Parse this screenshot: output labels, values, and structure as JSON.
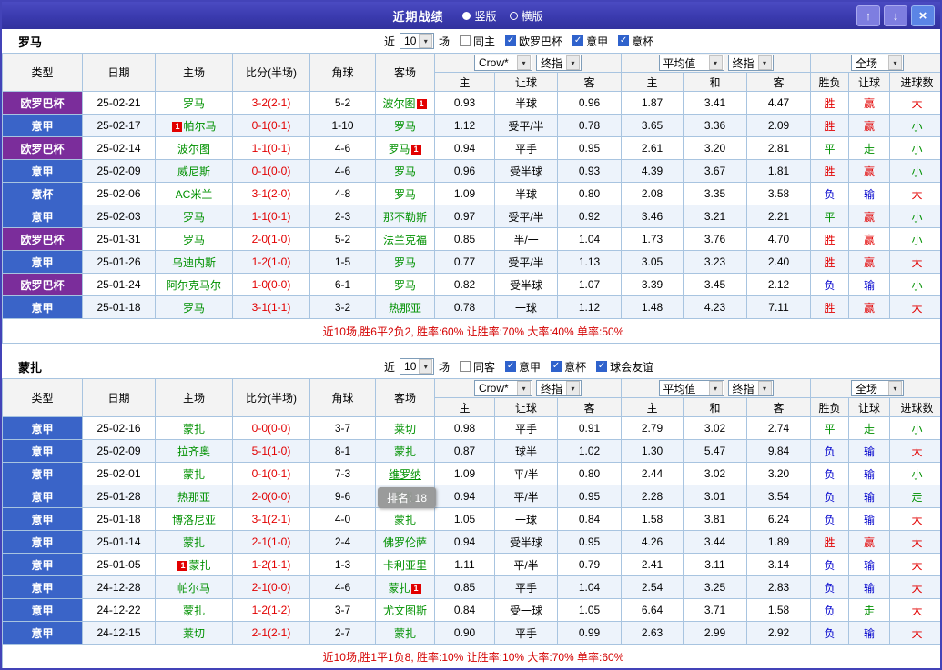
{
  "titlebar": {
    "title": "近期战绩",
    "radios": [
      {
        "label": "竖版",
        "selected": true
      },
      {
        "label": "横版",
        "selected": false
      }
    ]
  },
  "icons": {
    "up": "↑",
    "down": "↓",
    "close": "×",
    "check": "✓",
    "dropdown": "▾"
  },
  "colors": {
    "frame": "#4343b8",
    "team": "#009100",
    "score": "#e20000",
    "summary": "#d40000",
    "result_map": {
      "胜": "#e20000",
      "平": "#009100",
      "负": "#0000cc",
      "赢": "#e20000",
      "走": "#009100",
      "输": "#0000cc",
      "大": "#e20000",
      "小": "#009100"
    },
    "league_map": {
      "意甲": "#3a64c8",
      "意杯": "#3a64c8",
      "欧罗巴杯": "#7b2d9b"
    }
  },
  "table": {
    "badge_text": "1",
    "columns": [
      "类型",
      "日期",
      "主场",
      "比分(半场)",
      "角球",
      "客场",
      "主",
      "让球",
      "客",
      "主",
      "和",
      "客",
      "胜负",
      "让球",
      "进球数"
    ],
    "selects": {
      "company": "Crow*",
      "final1": "终指",
      "average": "平均值",
      "final2": "终指",
      "scope": "全场"
    }
  },
  "sections": [
    {
      "team": "罗马",
      "filter": {
        "prefix": "近",
        "count": "10",
        "suffix": "场",
        "checks": [
          {
            "label": "同主",
            "checked": false
          },
          {
            "label": "欧罗巴杯",
            "checked": true
          },
          {
            "label": "意甲",
            "checked": true
          },
          {
            "label": "意杯",
            "checked": true
          }
        ]
      },
      "rows": [
        {
          "league": "欧罗巴杯",
          "date": "25-02-21",
          "home": "罗马",
          "score": "3-2(2-1)",
          "corner": "5-2",
          "away": "波尔图",
          "away_badge": "after",
          "odds": [
            "0.93",
            "半球",
            "0.96",
            "1.87",
            "3.41",
            "4.47"
          ],
          "results": [
            "胜",
            "赢",
            "大"
          ]
        },
        {
          "league": "意甲",
          "date": "25-02-17",
          "home": "帕尔马",
          "home_badge": "before",
          "score": "0-1(0-1)",
          "corner": "1-10",
          "away": "罗马",
          "odds": [
            "1.12",
            "受平/半",
            "0.78",
            "3.65",
            "3.36",
            "2.09"
          ],
          "results": [
            "胜",
            "赢",
            "小"
          ]
        },
        {
          "league": "欧罗巴杯",
          "date": "25-02-14",
          "home": "波尔图",
          "score": "1-1(0-1)",
          "corner": "4-6",
          "away": "罗马",
          "away_badge": "after",
          "odds": [
            "0.94",
            "平手",
            "0.95",
            "2.61",
            "3.20",
            "2.81"
          ],
          "results": [
            "平",
            "走",
            "小"
          ]
        },
        {
          "league": "意甲",
          "date": "25-02-09",
          "home": "威尼斯",
          "score": "0-1(0-0)",
          "corner": "4-6",
          "away": "罗马",
          "odds": [
            "0.96",
            "受半球",
            "0.93",
            "4.39",
            "3.67",
            "1.81"
          ],
          "results": [
            "胜",
            "赢",
            "小"
          ]
        },
        {
          "league": "意杯",
          "date": "25-02-06",
          "home": "AC米兰",
          "score": "3-1(2-0)",
          "corner": "4-8",
          "away": "罗马",
          "odds": [
            "1.09",
            "半球",
            "0.80",
            "2.08",
            "3.35",
            "3.58"
          ],
          "results": [
            "负",
            "输",
            "大"
          ]
        },
        {
          "league": "意甲",
          "date": "25-02-03",
          "home": "罗马",
          "score": "1-1(0-1)",
          "corner": "2-3",
          "away": "那不勒斯",
          "odds": [
            "0.97",
            "受平/半",
            "0.92",
            "3.46",
            "3.21",
            "2.21"
          ],
          "results": [
            "平",
            "赢",
            "小"
          ]
        },
        {
          "league": "欧罗巴杯",
          "date": "25-01-31",
          "home": "罗马",
          "score": "2-0(1-0)",
          "corner": "5-2",
          "away": "法兰克福",
          "odds": [
            "0.85",
            "半/一",
            "1.04",
            "1.73",
            "3.76",
            "4.70"
          ],
          "results": [
            "胜",
            "赢",
            "小"
          ]
        },
        {
          "league": "意甲",
          "date": "25-01-26",
          "home": "乌迪内斯",
          "score": "1-2(1-0)",
          "corner": "1-5",
          "away": "罗马",
          "odds": [
            "0.77",
            "受平/半",
            "1.13",
            "3.05",
            "3.23",
            "2.40"
          ],
          "results": [
            "胜",
            "赢",
            "大"
          ]
        },
        {
          "league": "欧罗巴杯",
          "date": "25-01-24",
          "home": "阿尔克马尔",
          "score": "1-0(0-0)",
          "corner": "6-1",
          "away": "罗马",
          "odds": [
            "0.82",
            "受半球",
            "1.07",
            "3.39",
            "3.45",
            "2.12"
          ],
          "results": [
            "负",
            "输",
            "小"
          ]
        },
        {
          "league": "意甲",
          "date": "25-01-18",
          "home": "罗马",
          "score": "3-1(1-1)",
          "corner": "3-2",
          "away": "热那亚",
          "odds": [
            "0.78",
            "一球",
            "1.12",
            "1.48",
            "4.23",
            "7.11"
          ],
          "results": [
            "胜",
            "赢",
            "大"
          ]
        }
      ],
      "summary": "近10场,胜6平2负2, 胜率:60% 让胜率:70% 大率:40% 单率:50%"
    },
    {
      "team": "蒙扎",
      "filter": {
        "prefix": "近",
        "count": "10",
        "suffix": "场",
        "checks": [
          {
            "label": "同客",
            "checked": false
          },
          {
            "label": "意甲",
            "checked": true
          },
          {
            "label": "意杯",
            "checked": true
          },
          {
            "label": "球会友谊",
            "checked": true
          }
        ]
      },
      "rows": [
        {
          "league": "意甲",
          "date": "25-02-16",
          "home": "蒙扎",
          "score": "0-0(0-0)",
          "corner": "3-7",
          "away": "莱切",
          "odds": [
            "0.98",
            "平手",
            "0.91",
            "2.79",
            "3.02",
            "2.74"
          ],
          "results": [
            "平",
            "走",
            "小"
          ]
        },
        {
          "league": "意甲",
          "date": "25-02-09",
          "home": "拉齐奥",
          "score": "5-1(1-0)",
          "corner": "8-1",
          "away": "蒙扎",
          "odds": [
            "0.87",
            "球半",
            "1.02",
            "1.30",
            "5.47",
            "9.84"
          ],
          "results": [
            "负",
            "输",
            "大"
          ]
        },
        {
          "league": "意甲",
          "date": "25-02-01",
          "home": "蒙扎",
          "score": "0-1(0-1)",
          "corner": "7-3",
          "away": "维罗纳",
          "away_underline": true,
          "tooltip": "排名: 18",
          "odds": [
            "1.09",
            "平/半",
            "0.80",
            "2.44",
            "3.02",
            "3.20"
          ],
          "results": [
            "负",
            "输",
            "小"
          ]
        },
        {
          "league": "意甲",
          "date": "25-01-28",
          "home": "热那亚",
          "score": "2-0(0-0)",
          "corner": "9-6",
          "away": "蒙扎",
          "odds": [
            "0.94",
            "平/半",
            "0.95",
            "2.28",
            "3.01",
            "3.54"
          ],
          "results": [
            "负",
            "输",
            "走"
          ]
        },
        {
          "league": "意甲",
          "date": "25-01-18",
          "home": "博洛尼亚",
          "score": "3-1(2-1)",
          "corner": "4-0",
          "away": "蒙扎",
          "odds": [
            "1.05",
            "一球",
            "0.84",
            "1.58",
            "3.81",
            "6.24"
          ],
          "results": [
            "负",
            "输",
            "大"
          ]
        },
        {
          "league": "意甲",
          "date": "25-01-14",
          "home": "蒙扎",
          "score": "2-1(1-0)",
          "corner": "2-4",
          "away": "佛罗伦萨",
          "odds": [
            "0.94",
            "受半球",
            "0.95",
            "4.26",
            "3.44",
            "1.89"
          ],
          "results": [
            "胜",
            "赢",
            "大"
          ]
        },
        {
          "league": "意甲",
          "date": "25-01-05",
          "home": "蒙扎",
          "home_badge": "before",
          "score": "1-2(1-1)",
          "corner": "1-3",
          "away": "卡利亚里",
          "odds": [
            "1.11",
            "平/半",
            "0.79",
            "2.41",
            "3.11",
            "3.14"
          ],
          "results": [
            "负",
            "输",
            "大"
          ]
        },
        {
          "league": "意甲",
          "date": "24-12-28",
          "home": "帕尔马",
          "score": "2-1(0-0)",
          "corner": "4-6",
          "away": "蒙扎",
          "away_badge": "after",
          "odds": [
            "0.85",
            "平手",
            "1.04",
            "2.54",
            "3.25",
            "2.83"
          ],
          "results": [
            "负",
            "输",
            "大"
          ]
        },
        {
          "league": "意甲",
          "date": "24-12-22",
          "home": "蒙扎",
          "score": "1-2(1-2)",
          "corner": "3-7",
          "away": "尤文图斯",
          "odds": [
            "0.84",
            "受一球",
            "1.05",
            "6.64",
            "3.71",
            "1.58"
          ],
          "results": [
            "负",
            "走",
            "大"
          ]
        },
        {
          "league": "意甲",
          "date": "24-12-15",
          "home": "莱切",
          "score": "2-1(2-1)",
          "corner": "2-7",
          "away": "蒙扎",
          "odds": [
            "0.90",
            "平手",
            "0.99",
            "2.63",
            "2.99",
            "2.92"
          ],
          "results": [
            "负",
            "输",
            "大"
          ]
        }
      ],
      "summary": "近10场,胜1平1负8, 胜率:10% 让胜率:10% 大率:70% 单率:60%"
    }
  ]
}
